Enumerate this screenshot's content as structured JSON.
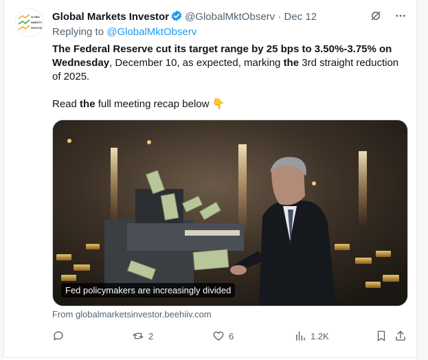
{
  "tweet": {
    "author_name": "Global Markets Investor",
    "handle": "@GlobalMktObserv",
    "separator": "·",
    "date": "Dec 12",
    "replying_prefix": "Replying to ",
    "replying_handle": "@GlobalMktObserv",
    "avatar_text": [
      "GLOBAL",
      "MARKETS",
      "INVESTOR"
    ],
    "body": {
      "b1": "The Federal Reserve cut its target range by 25 bps to 3.50%-3.75% on Wednesday",
      "n1": ", December 10, as expected, marking ",
      "b2": "the",
      "n2": " 3rd straight reduction of 2025.",
      "p2_n1": "Read ",
      "p2_b1": "the",
      "p2_n2": " full meeting recap below ",
      "emoji": "👇"
    },
    "media_caption": "Fed policymakers are increasingly divided",
    "link_source": "From globalmarketsinvestor.beehiiv.com",
    "stats": {
      "replies": "",
      "reposts": "2",
      "likes": "6",
      "views": "1.2K"
    }
  },
  "colors": {
    "accent": "#1d9bf0",
    "muted": "#536471",
    "text": "#0f1419"
  }
}
